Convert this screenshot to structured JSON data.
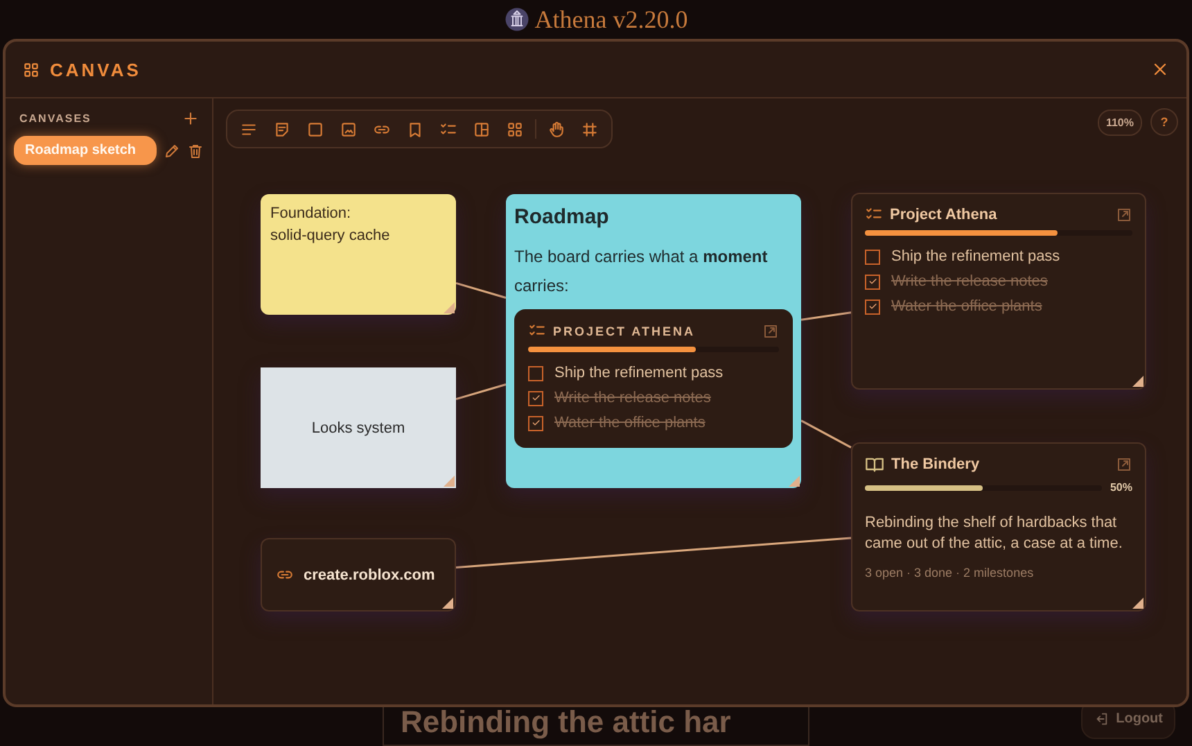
{
  "app_title": "Athena v2.20.0",
  "window": {
    "title": "CANVAS"
  },
  "sidebar": {
    "heading": "CANVASES",
    "items": [
      {
        "label": "Roadmap sketch",
        "selected": true
      }
    ]
  },
  "toolbar": {
    "tools": [
      {
        "kind": "text"
      },
      {
        "kind": "note"
      },
      {
        "kind": "shape"
      },
      {
        "kind": "image"
      },
      {
        "kind": "link"
      },
      {
        "kind": "bookmark"
      },
      {
        "kind": "checklist"
      },
      {
        "kind": "layout"
      },
      {
        "kind": "grid"
      },
      {
        "kind": "divider"
      },
      {
        "kind": "hand"
      },
      {
        "kind": "snap"
      }
    ]
  },
  "zoom": "110%",
  "help": "?",
  "nodes": [
    {
      "kind": "note",
      "color": "#f4e28c",
      "lines": [
        "Foundation:",
        "solid-query cache"
      ]
    },
    {
      "kind": "text-card",
      "color": "#7dd6de",
      "title": "Roadmap",
      "body": "The board carries what a **moment** carries:",
      "embed": {
        "title": "PROJECT ATHENA",
        "level": 0.67,
        "items": [
          {
            "text": "Ship the refinement pass",
            "checked": false
          },
          {
            "text": "Write the release notes",
            "checked": true
          },
          {
            "text": "Water the office plants",
            "checked": true
          }
        ]
      }
    },
    {
      "kind": "checklist",
      "title": "Project Athena",
      "level": 0.72,
      "items": [
        {
          "text": "Ship the refinement pass",
          "checked": false
        },
        {
          "text": "Write the release notes",
          "checked": true
        },
        {
          "text": "Water the office plants",
          "checked": true
        }
      ]
    },
    {
      "kind": "shape",
      "color": "#dde3e7",
      "text": "Looks system"
    },
    {
      "kind": "link",
      "url": "create.roblox.com"
    },
    {
      "kind": "project",
      "title": "The Bindery",
      "level": 0.5,
      "percent": "50%",
      "description": "Rebinding the shelf of hardbacks that came out of the attic, a case at a time.",
      "meta": "3 open · 3 done · 2 milestones"
    }
  ],
  "backdrop": {
    "heading": "Rebinding the attic har",
    "button": "Logout"
  }
}
